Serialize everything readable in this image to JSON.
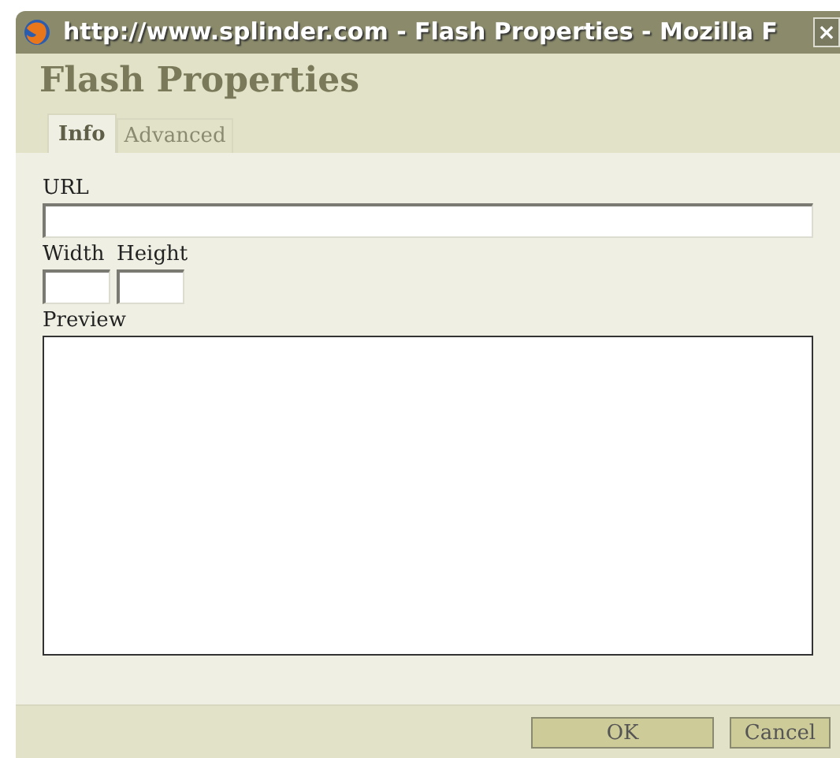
{
  "window": {
    "title": "http://www.splinder.com - Flash Properties - Mozilla F",
    "close": "×"
  },
  "dialog_title": "Flash Properties",
  "tabs": [
    {
      "label": "Info",
      "selected": true
    },
    {
      "label": "Advanced",
      "selected": false
    }
  ],
  "url": {
    "label": "URL"
  },
  "width": {
    "label": "Width"
  },
  "height": {
    "label": "Height"
  },
  "preview": {
    "label": "Preview"
  },
  "buttons": [
    "OK",
    "Cancel"
  ]
}
